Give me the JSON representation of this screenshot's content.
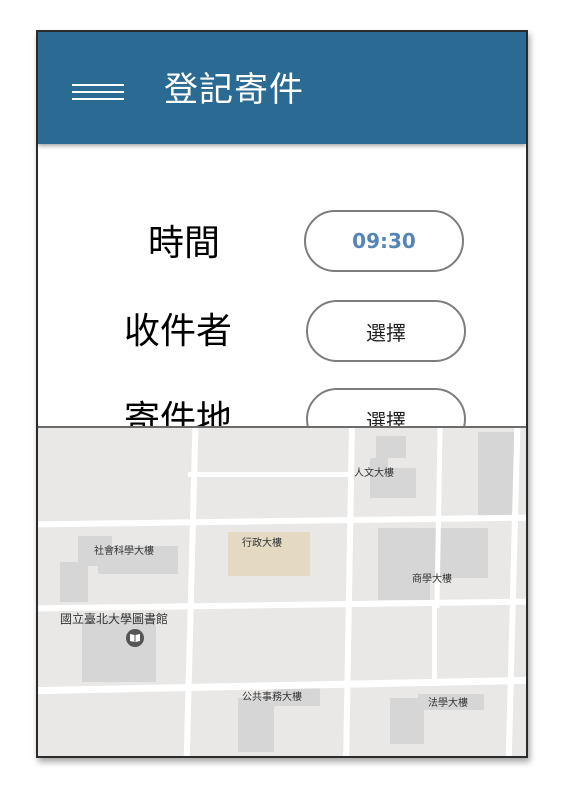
{
  "appbar": {
    "title": "登記寄件",
    "menu_icon": "hamburger-menu-icon",
    "color": "#2b6a92"
  },
  "form": {
    "time": {
      "label": "時間",
      "value": "09:30"
    },
    "recipient": {
      "label": "收件者",
      "button": "選擇"
    },
    "location": {
      "label": "寄件地",
      "button": "選擇"
    }
  },
  "map": {
    "labels": {
      "humanities": "人文大樓",
      "social_science": "社會科學大樓",
      "administration": "行政大樓",
      "business": "商學大樓",
      "library": "國立臺北大學圖書館",
      "public_affairs": "公共事務大樓",
      "law": "法學大樓"
    },
    "library_icon": "book-icon"
  }
}
